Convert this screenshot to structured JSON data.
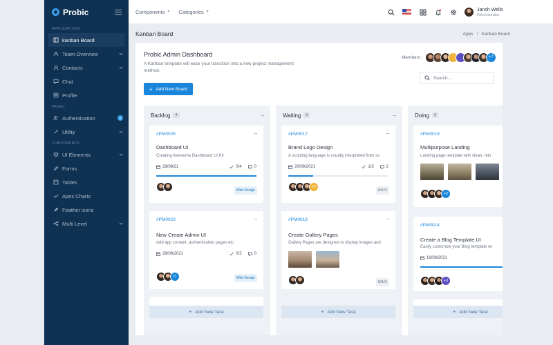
{
  "brand": {
    "name": "Probic"
  },
  "sidebar": {
    "sections": [
      {
        "label": "APPLICATIONS",
        "items": [
          {
            "label": "kanban Board",
            "icon": "board-icon",
            "active": true
          },
          {
            "label": "Team Overview",
            "icon": "team-icon",
            "chevron": true
          },
          {
            "label": "Contacts",
            "icon": "contacts-icon",
            "chevron": true
          },
          {
            "label": "Chat",
            "icon": "chat-icon"
          },
          {
            "label": "Profile",
            "icon": "profile-icon"
          }
        ]
      },
      {
        "label": "PAGES",
        "items": [
          {
            "label": "Authentication",
            "icon": "users-icon",
            "badge": "2"
          },
          {
            "label": "Utility",
            "icon": "utility-icon",
            "chevron": true
          }
        ]
      },
      {
        "label": "COMPONENTS",
        "items": [
          {
            "label": "UI Elements",
            "icon": "elements-icon",
            "chevron": true
          },
          {
            "label": "Forms",
            "icon": "forms-icon"
          },
          {
            "label": "Tables",
            "icon": "tables-icon"
          },
          {
            "label": "Apex Charts",
            "icon": "charts-icon"
          },
          {
            "label": "Feather icons",
            "icon": "feather-icon"
          },
          {
            "label": "Multi Level",
            "icon": "share-icon",
            "chevron": true
          }
        ]
      }
    ]
  },
  "topbar": {
    "components_label": "Components",
    "categories_label": "Categories",
    "user": {
      "name": "Jansh Wells",
      "role": "Administrator"
    }
  },
  "page": {
    "title": "Kanban Board",
    "breadcrumb": [
      "Apps",
      "Kanban Board"
    ]
  },
  "dashboard": {
    "title": "Probic Admin Dashboard",
    "description": "A Kanban template will ease your transition into a new project management method.",
    "add_board_label": "Add New Board",
    "members_label": "Members :",
    "members_more": "+7",
    "search_placeholder": "Search..."
  },
  "columns": [
    {
      "title": "Backlog",
      "count": "4",
      "add_task_label": "Add New Task",
      "cards": [
        {
          "id": "#PM0025",
          "title": "Dashboard UI",
          "desc": "Creating Awesome Dashboard UI Kit",
          "date": "28/08/21",
          "checks": "0/4",
          "comments": "0",
          "progress": 1.0,
          "tag": "Web Design"
        },
        {
          "id": "#PM0023",
          "title": "New Create Admin UI",
          "desc": "Add app content, authentication pages etc.",
          "date": "26/08/2021",
          "checks": "0/2",
          "comments": "0",
          "tag": "Web Design",
          "extra": "D"
        }
      ]
    },
    {
      "title": "Waiting",
      "count": "3",
      "add_task_label": "Add New Task",
      "cards": [
        {
          "id": "#PM0017",
          "title": "Brand Logo Design",
          "desc": "A scripting language is usually interpreted from so",
          "date": "20/08/2021",
          "checks": "1/3",
          "comments": "2",
          "progress": 0.25,
          "tag": "UI/UX",
          "extra": "+5"
        },
        {
          "id": "#PM0016",
          "title": "Create Gallery Pages",
          "desc": "Gallery Pages are designed to display images and",
          "tag": "UI/UX"
        }
      ]
    },
    {
      "title": "Doing",
      "count": "3",
      "add_task_label": "Add New Task",
      "cards": [
        {
          "id": "#PM0018",
          "title": "Multipurpose Landing",
          "desc": "Landing page template with clean, min",
          "extra": "+2"
        },
        {
          "id": "#PM0014",
          "title": "Create a Blog Template UI",
          "desc": "Easily customize your Blog template wi",
          "date": "16/08/2021",
          "progress": 0.95,
          "extra": "+3"
        }
      ]
    }
  ],
  "colors": {
    "accent": "#1a86db",
    "sidebar": "#0f3152",
    "orange": "#f0b43c",
    "purple": "#5b4fc4"
  }
}
